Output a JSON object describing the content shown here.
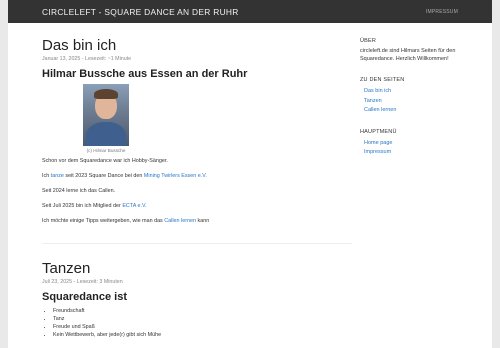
{
  "navbar": {
    "brand": "CIRCLELEFT - SQUARE DANCE AN DER RUHR",
    "link": "IMPRESSUM"
  },
  "post1": {
    "title": "Das bin ich",
    "meta": "Januar 13, 2025 - Lesezeit: ~1 Minute",
    "subtitle": "Hilmar Bussche aus Essen an der Ruhr",
    "caption": "(c) Hilmar Bussche",
    "p1": "Schon vor dem Squaredance war ich Hobby-Sänger.",
    "p2_a": "Ich ",
    "p2_link1": "tanze",
    "p2_b": " seit 2023 Square Dance bei den ",
    "p2_link2": "Mining Twirlers Essen e.V.",
    "p3": "Seit 2024 lerne ich das Callen.",
    "p4_a": "Seit Juli 2025 bin ich Mitglied der ",
    "p4_link": "ECTA e.V.",
    "p5_a": "Ich möchte einige Tipps weitergeben, wie man das ",
    "p5_link": "Callen lernen",
    "p5_b": " kann"
  },
  "post2": {
    "title": "Tanzen",
    "meta": "Juli 23, 2025 - Lesezeit: 3 Minuten",
    "subtitle": "Squaredance ist",
    "items": [
      "Freundschaft",
      "Tanz",
      "Freude und Spaß",
      "Kein Wettbewerb, aber jede(r) gibt sich Mühe"
    ]
  },
  "sidebar": {
    "about_title": "ÜBER",
    "about_text": "circleleft.de sind Hilmars Seiten für den Squaredance. Herzlich Willkommen!",
    "pages_title": "ZU DEN SEITEN",
    "pages": [
      "Das bin ich",
      "Tanzen",
      "Callen lernen"
    ],
    "menu_title": "HAUPTMENÜ",
    "menu": [
      "Home page",
      "Impressum"
    ]
  },
  "colors": {
    "navbar": "#333333",
    "link": "#2a76c6",
    "background": "#e9e9e9"
  }
}
